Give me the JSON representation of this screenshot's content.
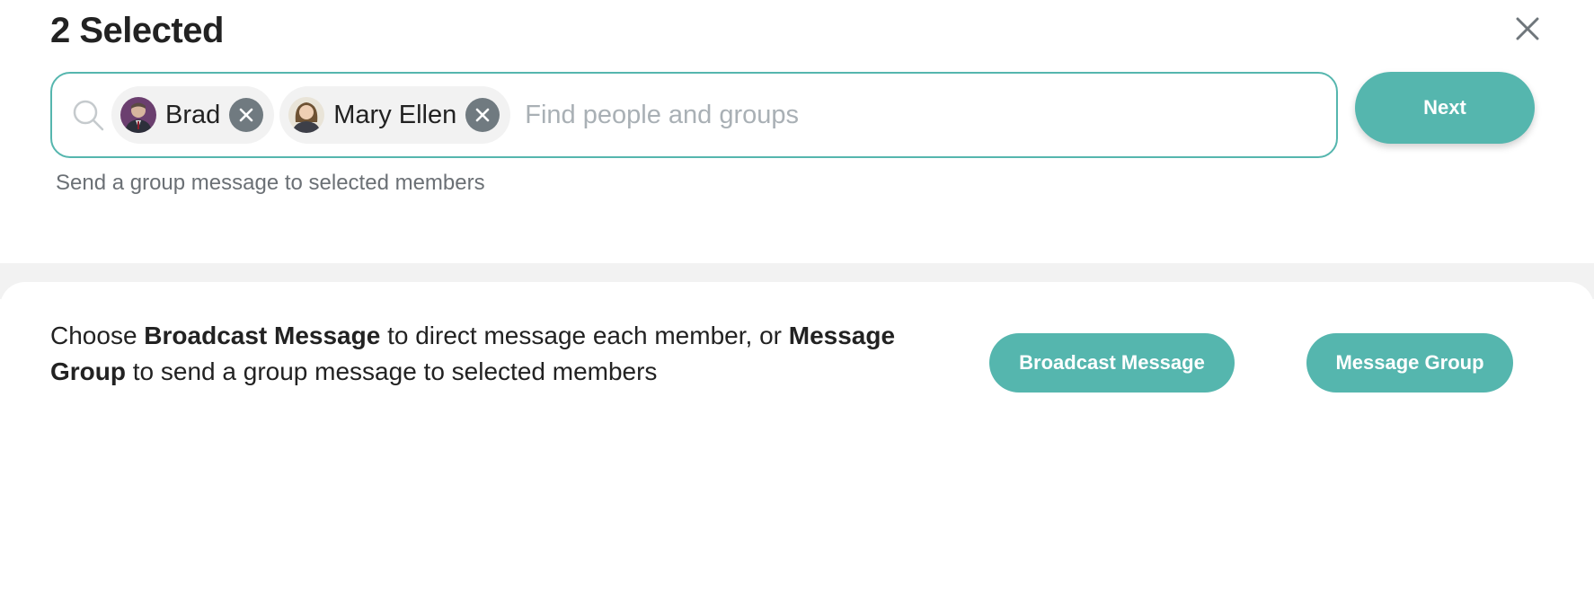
{
  "header": {
    "title": "2 Selected",
    "close_icon": "close-icon"
  },
  "search": {
    "icon": "search-icon",
    "placeholder": "Find people and groups",
    "value": "",
    "chips": [
      {
        "label": "Brad",
        "avatar": "avatar-photo",
        "remove_icon": "close-circle-icon"
      },
      {
        "label": "Mary Ellen",
        "avatar": "avatar-photo",
        "remove_icon": "close-circle-icon"
      }
    ]
  },
  "next_button": {
    "label": "Next"
  },
  "helper_text": "Send a group message to selected members",
  "info": {
    "part1": "Choose ",
    "bold1": "Broadcast Message",
    "part2": " to direct message each member, or ",
    "bold2": "Message Group",
    "part3": " to send a group message to selected members"
  },
  "actions": {
    "broadcast_label": "Broadcast Message",
    "group_label": "Message Group"
  },
  "colors": {
    "accent": "#55b6ae",
    "chip_bg": "#f2f2f2",
    "remove_bg": "#707a80",
    "helper_text": "#6b7075",
    "placeholder": "#a9b0b5",
    "band": "#f2f2f2"
  }
}
